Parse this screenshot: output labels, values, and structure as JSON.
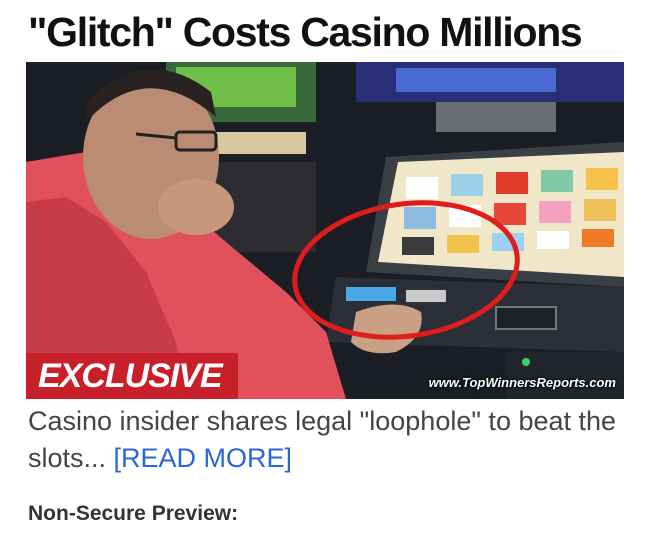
{
  "ad": {
    "headline": "\"Glitch\" Costs Casino Millions",
    "badge": "EXCLUSIVE",
    "watermark": "www.TopWinnersReports.com",
    "teaser": "Casino insider shares legal \"loophole\" to beat the slots... ",
    "read_more": "[READ MORE]",
    "footer_notice": "Non-Secure Preview:"
  },
  "colors": {
    "badge_bg": "#c8202a",
    "link": "#2a65d9",
    "circle": "#e01c1c"
  }
}
